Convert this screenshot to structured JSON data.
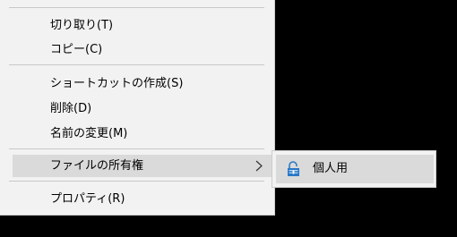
{
  "context_menu": {
    "items": [
      {
        "label": "切り取り(T)"
      },
      {
        "label": "コピー(C)"
      },
      {
        "label": "ショートカットの作成(S)"
      },
      {
        "label": "削除(D)"
      },
      {
        "label": "名前の変更(M)"
      },
      {
        "label": "ファイルの所有権",
        "has_submenu": true
      },
      {
        "label": "プロパティ(R)"
      }
    ]
  },
  "submenu": {
    "items": [
      {
        "label": "個人用",
        "icon": "unlock-icon"
      }
    ]
  },
  "colors": {
    "menu_background": "#f2f2f2",
    "hover_background": "#dadada",
    "separator": "#c8c8c8",
    "icon_blue": "#2a78c7",
    "desktop_background": "#000000"
  }
}
